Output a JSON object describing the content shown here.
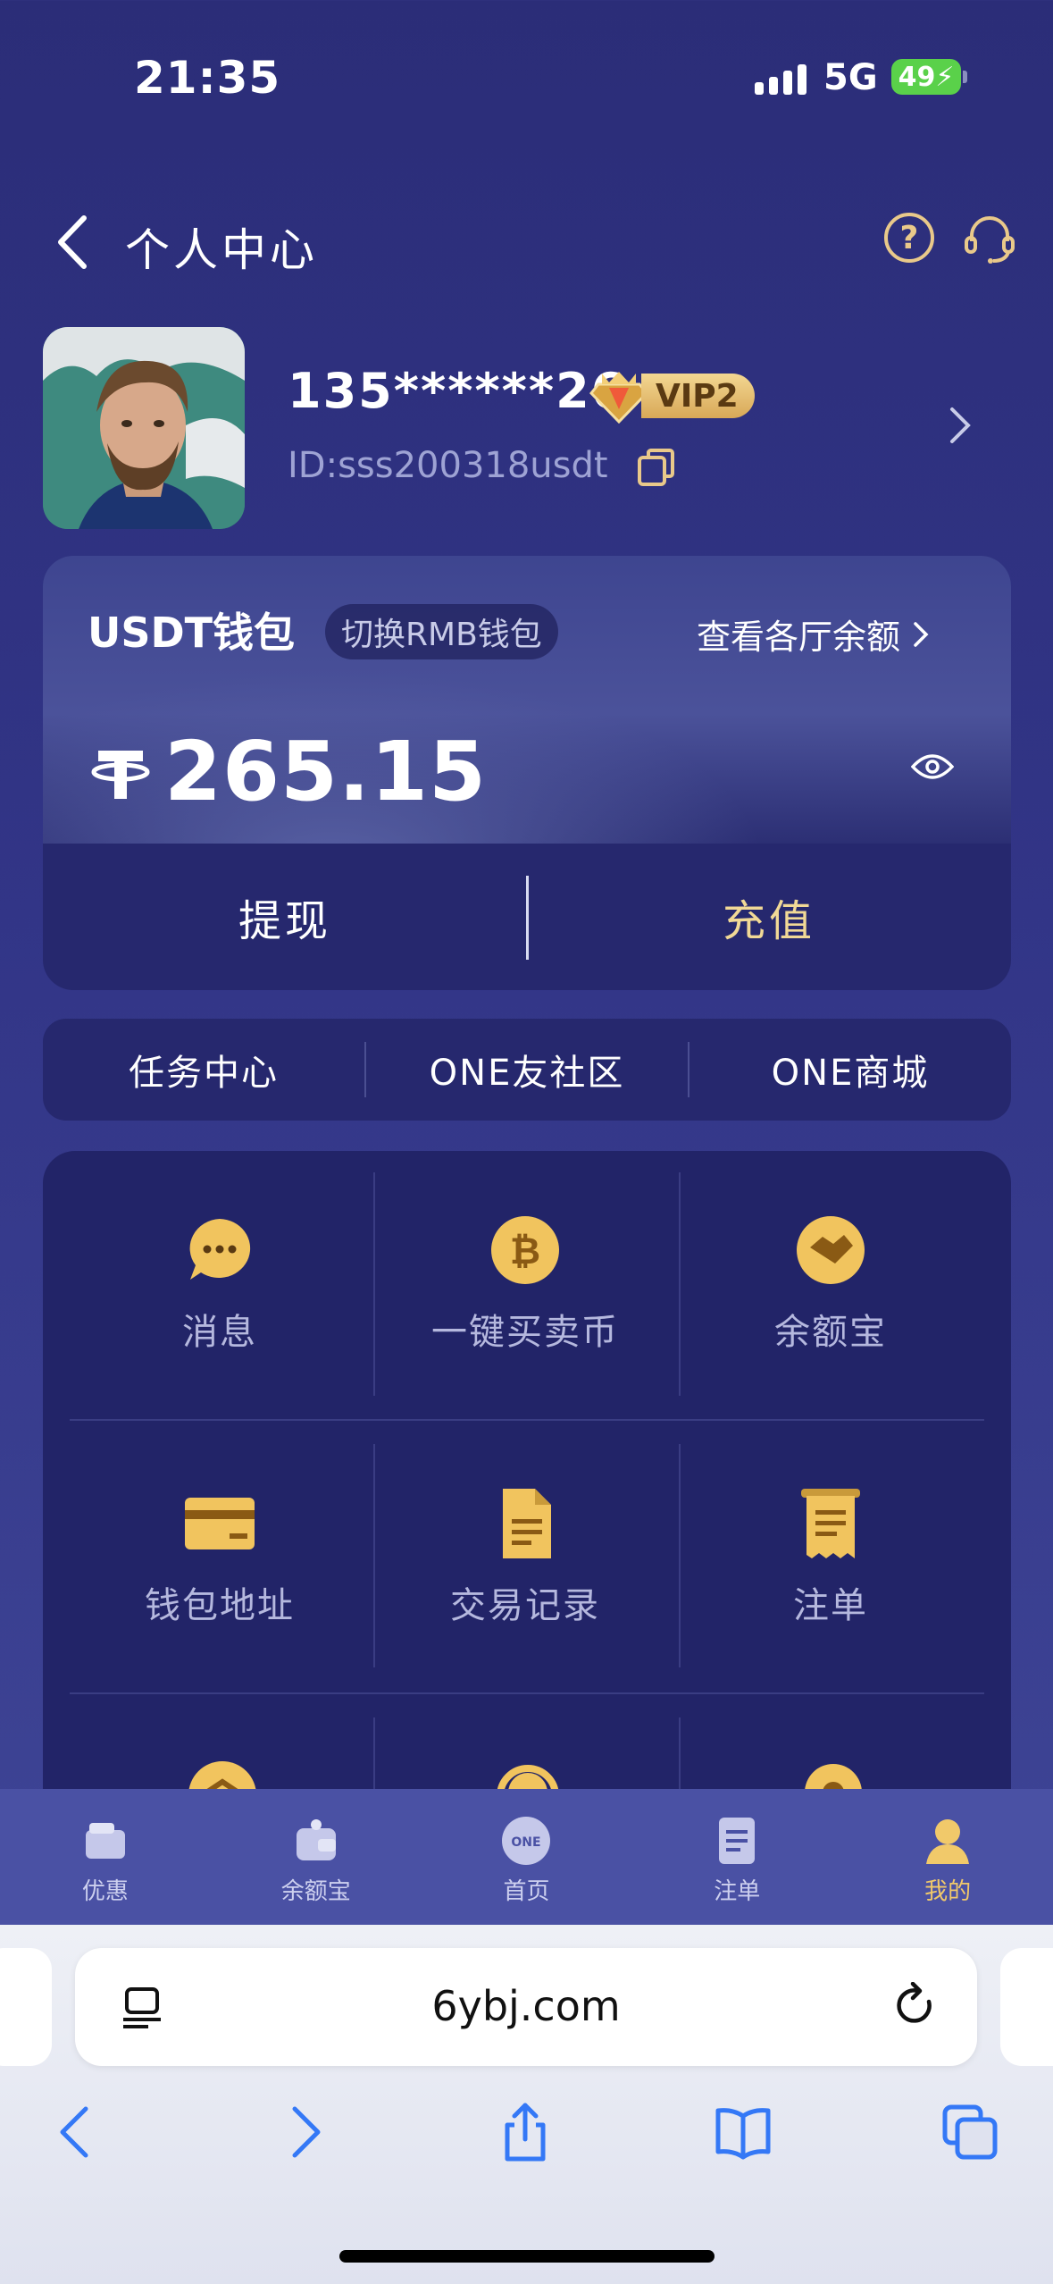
{
  "status_bar": {
    "time": "21:35",
    "network": "5G",
    "battery": "49"
  },
  "header": {
    "title": "个人中心"
  },
  "profile": {
    "username": "135******26",
    "vip_label": "VIP2",
    "user_id": "ID:sss200318usdt"
  },
  "wallet": {
    "title": "USDT钱包",
    "switch_label": "切换RMB钱包",
    "view_all_label": "查看各厅余额",
    "balance": "265.15",
    "withdraw_label": "提现",
    "recharge_label": "充值"
  },
  "quick_links": [
    "任务中心",
    "ONE友社区",
    "ONE商城"
  ],
  "grid_items": [
    {
      "label": "消息",
      "icon": "message-icon"
    },
    {
      "label": "一键买卖币",
      "icon": "bitcoin-icon"
    },
    {
      "label": "余额宝",
      "icon": "handshake-icon"
    },
    {
      "label": "钱包地址",
      "icon": "card-icon"
    },
    {
      "label": "交易记录",
      "icon": "document-icon"
    },
    {
      "label": "注单",
      "icon": "receipt-icon"
    }
  ],
  "tabbar": [
    {
      "label": "优惠",
      "icon": "promo-wallet-icon"
    },
    {
      "label": "余额宝",
      "icon": "balance-bag-icon"
    },
    {
      "label": "首页",
      "icon": "home-logo-icon"
    },
    {
      "label": "注单",
      "icon": "bet-slip-icon"
    },
    {
      "label": "我的",
      "icon": "profile-icon"
    }
  ],
  "browser": {
    "url": "6ybj.com"
  },
  "colors": {
    "accent_gold": "#f1c96a",
    "background": "#2b2d78",
    "card": "#26286e"
  }
}
